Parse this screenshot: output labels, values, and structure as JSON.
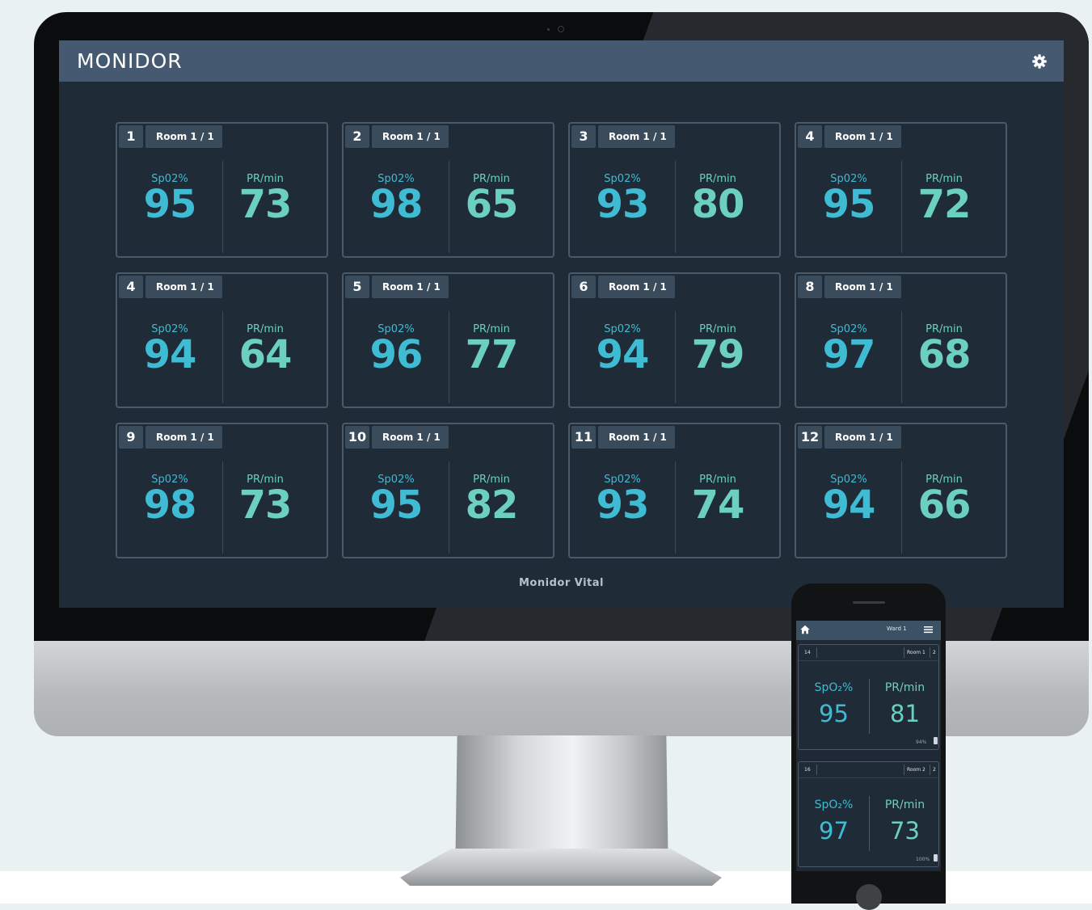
{
  "app": {
    "title": "MONIDOR",
    "footer": "Monidor Vital"
  },
  "icons": {
    "settings": "gear-icon",
    "home": "home-icon",
    "menu": "hamburger-menu-icon",
    "battery": "battery-icon"
  },
  "colors": {
    "header": "#455a70",
    "screen_bg": "#1f2b37",
    "spo2": "#3fbcd3",
    "pulse": "#6cd0c0"
  },
  "cards": [
    {
      "num": "1",
      "room": "Room 1 / 1",
      "spo2_label": "Sp02%",
      "spo2": "95",
      "pr_label": "PR/min",
      "pr": "73"
    },
    {
      "num": "2",
      "room": "Room 1 / 1",
      "spo2_label": "Sp02%",
      "spo2": "98",
      "pr_label": "PR/min",
      "pr": "65"
    },
    {
      "num": "3",
      "room": "Room 1 / 1",
      "spo2_label": "Sp02%",
      "spo2": "93",
      "pr_label": "PR/min",
      "pr": "80"
    },
    {
      "num": "4",
      "room": "Room 1 / 1",
      "spo2_label": "Sp02%",
      "spo2": "95",
      "pr_label": "PR/min",
      "pr": "72"
    },
    {
      "num": "4",
      "room": "Room 1 / 1",
      "spo2_label": "Sp02%",
      "spo2": "94",
      "pr_label": "PR/min",
      "pr": "64"
    },
    {
      "num": "5",
      "room": "Room 1 / 1",
      "spo2_label": "Sp02%",
      "spo2": "96",
      "pr_label": "PR/min",
      "pr": "77"
    },
    {
      "num": "6",
      "room": "Room 1 / 1",
      "spo2_label": "Sp02%",
      "spo2": "94",
      "pr_label": "PR/min",
      "pr": "79"
    },
    {
      "num": "8",
      "room": "Room 1 / 1",
      "spo2_label": "Sp02%",
      "spo2": "97",
      "pr_label": "PR/min",
      "pr": "68"
    },
    {
      "num": "9",
      "room": "Room 1 / 1",
      "spo2_label": "Sp02%",
      "spo2": "98",
      "pr_label": "PR/min",
      "pr": "73"
    },
    {
      "num": "10",
      "room": "Room 1 / 1",
      "spo2_label": "Sp02%",
      "spo2": "95",
      "pr_label": "PR/min",
      "pr": "82"
    },
    {
      "num": "11",
      "room": "Room 1 / 1",
      "spo2_label": "Sp02%",
      "spo2": "93",
      "pr_label": "PR/min",
      "pr": "74"
    },
    {
      "num": "12",
      "room": "Room 1 / 1",
      "spo2_label": "Sp02%",
      "spo2": "94",
      "pr_label": "PR/min",
      "pr": "66"
    }
  ],
  "phone": {
    "ward": "Ward 1",
    "cards": [
      {
        "num": "14",
        "room": "Room 1",
        "bed": "2",
        "spo2_label": "SpO₂%",
        "spo2": "95",
        "pr_label": "PR/min",
        "pr": "81",
        "battery": "94%"
      },
      {
        "num": "16",
        "room": "Room 2",
        "bed": "2",
        "spo2_label": "SpO₂%",
        "spo2": "97",
        "pr_label": "PR/min",
        "pr": "73",
        "battery": "100%"
      }
    ]
  }
}
